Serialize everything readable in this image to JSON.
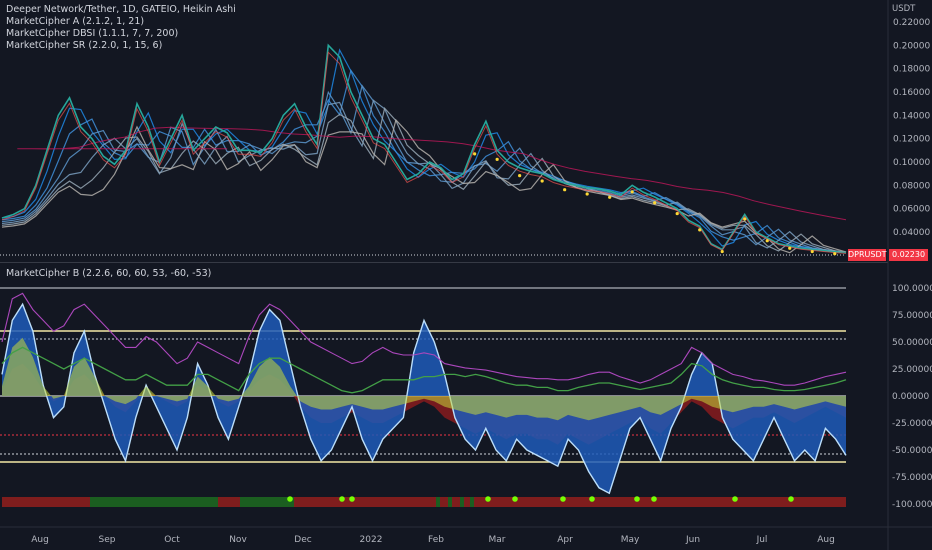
{
  "header": {
    "symbol_line": "Deeper Network/Tether, 1D, GATEIO, Heikin Ashi",
    "indicators": [
      "MarketCipher A (2.1.2, 1, 21)",
      "MarketCipher DBSI (1.1.1, 7, 7, 200)",
      "MarketCipher SR (2.2.0, 1, 15, 6)"
    ],
    "currency": "USDT"
  },
  "oscillator_pane": {
    "title": "MarketCipher B (2.2.6, 60, 60, 53, -60, -53)"
  },
  "price_tags": {
    "symbol": "DPRUSDT",
    "last_price": "0.02230"
  },
  "chart_data": [
    {
      "type": "line",
      "title": "",
      "y_unit": "USDT",
      "ylim": [
        0.01,
        0.22
      ],
      "y_ticks": [
        "0.22000",
        "0.20000",
        "0.18000",
        "0.16000",
        "0.14000",
        "0.12000",
        "0.10000",
        "0.08000",
        "0.06000",
        "0.04000"
      ],
      "x_ticks": [
        "Aug",
        "Sep",
        "Oct",
        "Nov",
        "Dec",
        "2022",
        "Feb",
        "Mar",
        "Apr",
        "May",
        "Jun",
        "Jul",
        "Aug"
      ],
      "series": [
        {
          "values": [
            0.052,
            0.055,
            0.06,
            0.08,
            0.11,
            0.14,
            0.155,
            0.13,
            0.12,
            0.105,
            0.098,
            0.11,
            0.15,
            0.13,
            0.1,
            0.12,
            0.14,
            0.11,
            0.12,
            0.13,
            0.125,
            0.11,
            0.11,
            0.108,
            0.12,
            0.14,
            0.15,
            0.13,
            0.115,
            0.2,
            0.19,
            0.16,
            0.14,
            0.12,
            0.115,
            0.1,
            0.085,
            0.09,
            0.1,
            0.095,
            0.085,
            0.09,
            0.115,
            0.135,
            0.11,
            0.1,
            0.095,
            0.092,
            0.09,
            0.085,
            0.082,
            0.08,
            0.078,
            0.077,
            0.075,
            0.072,
            0.08,
            0.074,
            0.07,
            0.065,
            0.06,
            0.05,
            0.045,
            0.03,
            0.025,
            0.04,
            0.055,
            0.04,
            0.035,
            0.03,
            0.028,
            0.026,
            0.025,
            0.024,
            0.023,
            0.0223
          ]
        }
      ]
    },
    {
      "type": "area",
      "title": "",
      "ylim": [
        -110,
        110
      ],
      "y_ticks": [
        "100.00000",
        "75.00000",
        "50.00000",
        "25.00000",
        "0.00000",
        "-25.00000",
        "-50.00000",
        "-75.00000",
        "-100.00000"
      ],
      "series": [
        {
          "values": [
            20,
            70,
            85,
            60,
            10,
            -20,
            -10,
            40,
            60,
            20,
            -10,
            -40,
            -60,
            -20,
            10,
            -10,
            -30,
            -50,
            -20,
            30,
            10,
            -20,
            -40,
            -10,
            20,
            60,
            80,
            70,
            30,
            -10,
            -40,
            -60,
            -50,
            -30,
            -10,
            -40,
            -60,
            -40,
            -30,
            -20,
            40,
            70,
            50,
            20,
            -20,
            -40,
            -50,
            -30,
            -50,
            -60,
            -40,
            -50,
            -55,
            -60,
            -65,
            -40,
            -50,
            -70,
            -85,
            -90,
            -60,
            -30,
            -20,
            -40,
            -60,
            -30,
            -10,
            20,
            40,
            30,
            -20,
            -40,
            -50,
            -60,
            -40,
            -20,
            -40,
            -60,
            -50,
            -60,
            -30,
            -40,
            -55
          ]
        },
        {
          "values": [
            5,
            25,
            30,
            20,
            5,
            -5,
            0,
            15,
            20,
            10,
            0,
            -10,
            -15,
            -5,
            5,
            0,
            -5,
            -10,
            -5,
            10,
            5,
            -5,
            -10,
            -5,
            5,
            15,
            20,
            15,
            5,
            -10,
            -20,
            -25,
            -25,
            -20,
            -15,
            -20,
            -25,
            -25,
            -20,
            -15,
            -10,
            -5,
            -10,
            -20,
            -25,
            -30,
            -35,
            -30,
            -35,
            -40,
            -35,
            -35,
            -40,
            -40,
            -45,
            -35,
            -40,
            -45,
            -40,
            -35,
            -30,
            -25,
            -20,
            -30,
            -35,
            -25,
            -15,
            -5,
            -10,
            -20,
            -25,
            -30,
            -25,
            -20,
            -20,
            -15,
            -20,
            -25,
            -20,
            -15,
            -10,
            -15,
            -20
          ]
        },
        {
          "values": [
            30,
            40,
            45,
            40,
            35,
            30,
            25,
            30,
            35,
            30,
            25,
            20,
            15,
            15,
            20,
            15,
            10,
            10,
            10,
            20,
            20,
            15,
            10,
            5,
            20,
            30,
            35,
            35,
            30,
            25,
            20,
            15,
            10,
            5,
            3,
            5,
            10,
            15,
            15,
            15,
            15,
            18,
            18,
            20,
            20,
            18,
            20,
            18,
            15,
            12,
            10,
            10,
            8,
            8,
            5,
            5,
            8,
            10,
            12,
            12,
            10,
            8,
            6,
            8,
            10,
            12,
            20,
            30,
            28,
            20,
            15,
            12,
            10,
            8,
            8,
            6,
            5,
            5,
            6,
            8,
            10,
            12,
            15
          ]
        },
        {
          "values": [
            50,
            90,
            95,
            80,
            70,
            60,
            65,
            80,
            85,
            75,
            65,
            55,
            45,
            45,
            55,
            50,
            40,
            30,
            35,
            50,
            45,
            40,
            35,
            30,
            55,
            75,
            85,
            80,
            70,
            60,
            50,
            45,
            40,
            35,
            30,
            32,
            40,
            45,
            40,
            38,
            38,
            40,
            38,
            30,
            28,
            26,
            25,
            24,
            22,
            20,
            18,
            17,
            16,
            16,
            15,
            15,
            17,
            20,
            22,
            22,
            18,
            15,
            12,
            15,
            20,
            25,
            30,
            45,
            40,
            30,
            25,
            20,
            18,
            15,
            14,
            12,
            10,
            10,
            12,
            15,
            18,
            20,
            22
          ]
        }
      ]
    }
  ]
}
